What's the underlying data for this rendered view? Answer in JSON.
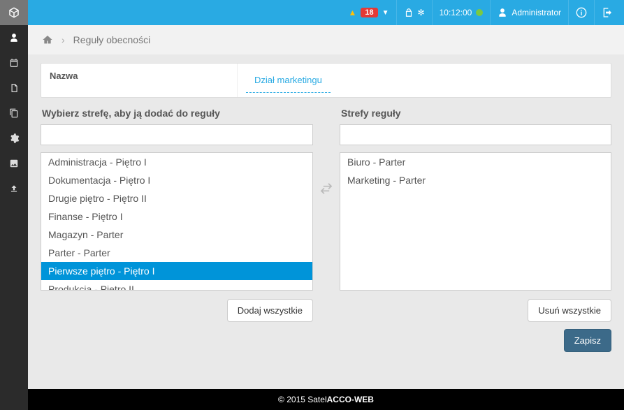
{
  "topbar": {
    "alerts_count": "18",
    "time": "10:12:00",
    "user_label": "Administrator"
  },
  "breadcrumb": {
    "page": "Reguły obecności"
  },
  "name_field": {
    "label": "Nazwa",
    "value": "Dział marketingu"
  },
  "left_column": {
    "title": "Wybierz strefę, aby ją dodać do reguły",
    "search_placeholder": "",
    "items": [
      {
        "label": "Administracja - Piętro I",
        "selected": false
      },
      {
        "label": "Dokumentacja - Piętro I",
        "selected": false
      },
      {
        "label": "Drugie piętro - Piętro II",
        "selected": false
      },
      {
        "label": "Finanse - Piętro I",
        "selected": false
      },
      {
        "label": "Magazyn - Parter",
        "selected": false
      },
      {
        "label": "Parter - Parter",
        "selected": false
      },
      {
        "label": "Pierwsze piętro  - Piętro I",
        "selected": true
      },
      {
        "label": "Produkcja - Piętro II",
        "selected": false
      }
    ],
    "add_all_label": "Dodaj wszystkie"
  },
  "right_column": {
    "title": "Strefy reguły",
    "search_placeholder": "",
    "items": [
      {
        "label": "Biuro - Parter",
        "selected": false
      },
      {
        "label": "Marketing - Parter",
        "selected": false
      }
    ],
    "remove_all_label": "Usuń wszystkie",
    "save_label": "Zapisz"
  },
  "footer": {
    "prefix": "© 2015 Satel ",
    "bold": "ACCO-WEB"
  }
}
